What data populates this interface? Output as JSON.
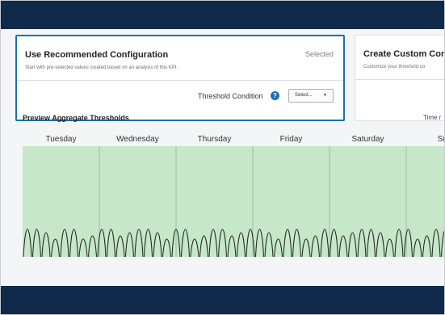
{
  "recommended": {
    "title": "Use Recommended Configuration",
    "description": "Start with pre-selected values created based on an analysis of this KPI.",
    "status": "Selected",
    "threshold_label": "Threshold Condition",
    "select_label": "Select...",
    "select_caret": "▼"
  },
  "custom": {
    "title": "Create Custom Confi",
    "description": "Customize your threshold co"
  },
  "preview": {
    "title": "Preview Aggregate Thresholds",
    "time_label": "Time r"
  },
  "days": [
    "Tuesday",
    "Wednesday",
    "Thursday",
    "Friday",
    "Saturday",
    "Sun"
  ],
  "colors": {
    "nav": "#0f2a4a",
    "accent": "#1a6fb5",
    "chart_fill": "#c6e8c9",
    "chart_divider": "#9fbfa3",
    "spike_stroke": "#222222"
  },
  "icons": {
    "help": "?"
  }
}
